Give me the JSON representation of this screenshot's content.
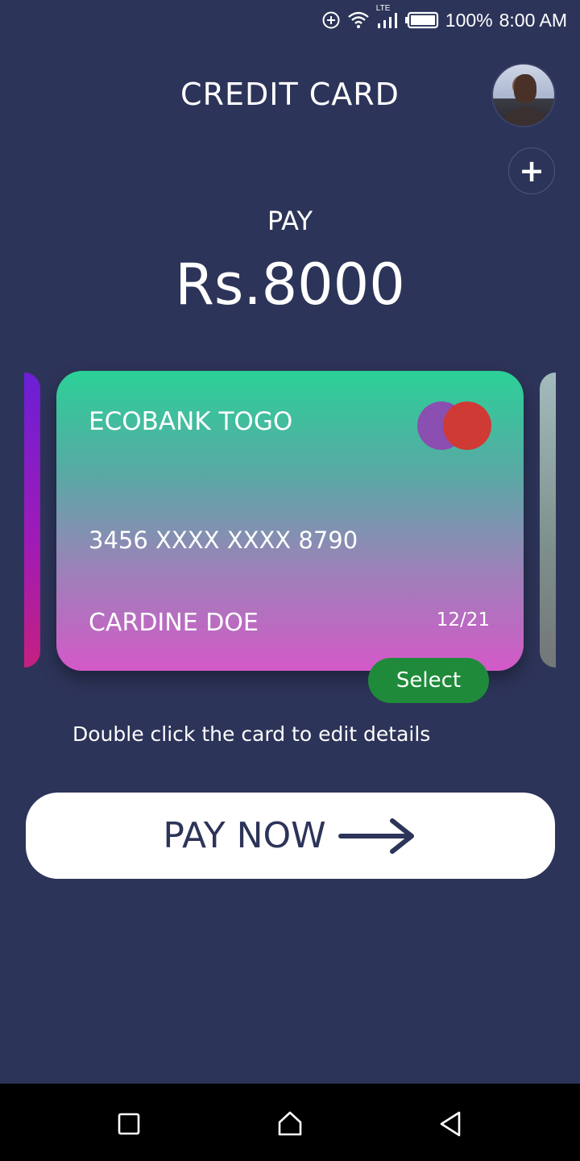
{
  "status_bar": {
    "battery": "100%",
    "time": "8:00 AM",
    "network": "LTE",
    "icons": [
      "data-saver-icon",
      "wifi-icon",
      "signal-icon",
      "battery-icon"
    ]
  },
  "header": {
    "title": "CREDIT CARD"
  },
  "payment": {
    "label": "PAY",
    "amount": "Rs.8000"
  },
  "card": {
    "bank": "ECOBANK TOGO",
    "number": "3456 XXXX XXXX 8790",
    "holder": "CARDINE DOE",
    "expiry": "12/21",
    "select_label": "Select",
    "logo": "mastercard-logo-icon",
    "gradient": [
      "#2bd097",
      "#d459c8"
    ]
  },
  "hint": "Double click the card to edit details",
  "pay_now": {
    "label": "PAY NOW",
    "icon": "arrow-right-icon"
  },
  "nav": {
    "icons": [
      "recents-icon",
      "home-icon",
      "back-icon"
    ]
  },
  "colors": {
    "background": "#2d3459",
    "select_button": "#1f8b3a",
    "pay_now_bg": "#ffffff",
    "pay_now_text": "#2d3459"
  }
}
